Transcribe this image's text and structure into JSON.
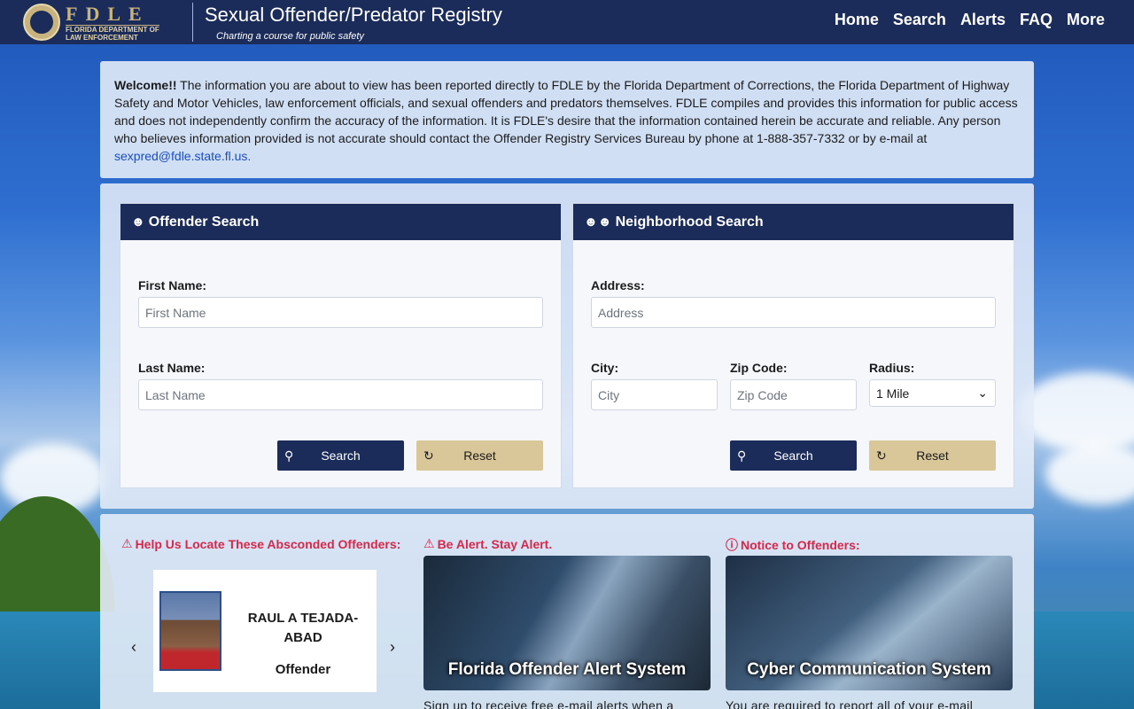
{
  "header": {
    "brand_big": "FDLE",
    "brand_small_1": "FLORIDA DEPARTMENT OF",
    "brand_small_2": "LAW ENFORCEMENT",
    "title": "Sexual Offender/Predator Registry",
    "tagline": "Charting a course for public safety",
    "nav": [
      "Home",
      "Search",
      "Alerts",
      "FAQ",
      "More"
    ]
  },
  "welcome": {
    "lead": "Welcome!!",
    "text": " The information you are about to view has been reported directly to FDLE by the Florida Department of Corrections, the Florida Department of Highway Safety and Motor Vehicles, law enforcement officials, and sexual offenders and predators themselves. FDLE compiles and provides this information for public access and does not independently confirm the accuracy of the information. It is FDLE's desire that the information contained herein be accurate and reliable. Any person who believes information provided is not accurate should contact the Offender Registry Services Bureau by phone at 1-888-357-7332 or by e-mail at ",
    "email": "sexpred@fdle.state.fl.us."
  },
  "offender_search": {
    "title": "Offender Search",
    "first_label": "First Name:",
    "first_placeholder": "First Name",
    "last_label": "Last Name:",
    "last_placeholder": "Last Name",
    "search": "Search",
    "reset": "Reset"
  },
  "neighborhood_search": {
    "title": "Neighborhood Search",
    "address_label": "Address:",
    "address_placeholder": "Address",
    "city_label": "City:",
    "city_placeholder": "City",
    "zip_label": "Zip Code:",
    "zip_placeholder": "Zip Code",
    "radius_label": "Radius:",
    "radius_value": "1 Mile",
    "search": "Search",
    "reset": "Reset"
  },
  "absconded": {
    "title": "Help Us Locate These Absconded Offenders:",
    "name": "RAUL A TEJADA-ABAD",
    "role": "Offender"
  },
  "alert": {
    "title": "Be Alert. Stay Alert.",
    "caption": "Florida Offender Alert System",
    "text": "Sign up to receive free e-mail alerts when a"
  },
  "notice": {
    "title": "Notice to Offenders:",
    "caption": "Cyber Communication System",
    "text": "You are required to report all of your e-mail"
  },
  "colors": {
    "navy": "#1b2b5a",
    "gold": "#c8b37e",
    "reset_button": "#d9c79a",
    "alert_red": "#d8274a"
  }
}
